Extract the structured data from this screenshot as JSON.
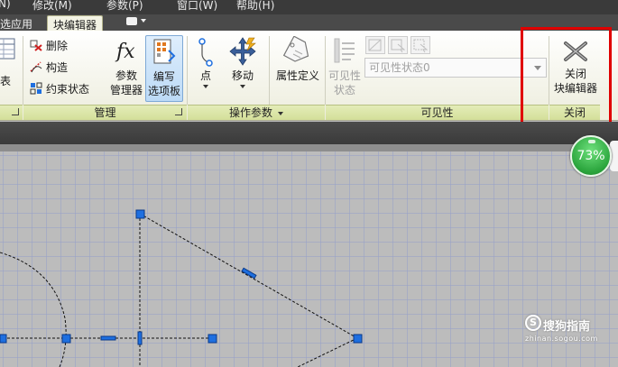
{
  "menu": {
    "items": [
      "N)",
      "修改(M)",
      "参数(P)",
      "窗口(W)",
      "帮助(H)"
    ]
  },
  "tabs": [
    {
      "label": "筛选应用",
      "active": false
    },
    {
      "label": "块编辑器",
      "active": true
    }
  ],
  "ribbon": {
    "left_partial_label": "表",
    "manage": {
      "title": "管理",
      "delete": "删除",
      "construct": "构造",
      "constraint_state": "约束状态",
      "param_manager_l1": "参数",
      "param_manager_l2": "管理器",
      "author_palette_l1": "编写",
      "author_palette_l2": "选项板"
    },
    "action_params": {
      "title": "操作参数",
      "point": "点",
      "move": "移动",
      "attr_def": "属性定义"
    },
    "visibility": {
      "title": "可见性",
      "vis_state_l1": "可见性",
      "vis_state_l2": "状态",
      "combo_value": "可见性状态0"
    },
    "close": {
      "title": "关闭",
      "close_l1": "关闭",
      "close_l2": "块编辑器"
    }
  },
  "zoom": {
    "value": "73%"
  },
  "watermark": {
    "logo": "S",
    "brand": "搜狗指南",
    "url": "zhinan.sogou.com"
  },
  "colors": {
    "accent_panel": "#d4df99",
    "highlight": "#e00000",
    "grip": "#1e6fe0",
    "zoom": "#2aa43c"
  }
}
